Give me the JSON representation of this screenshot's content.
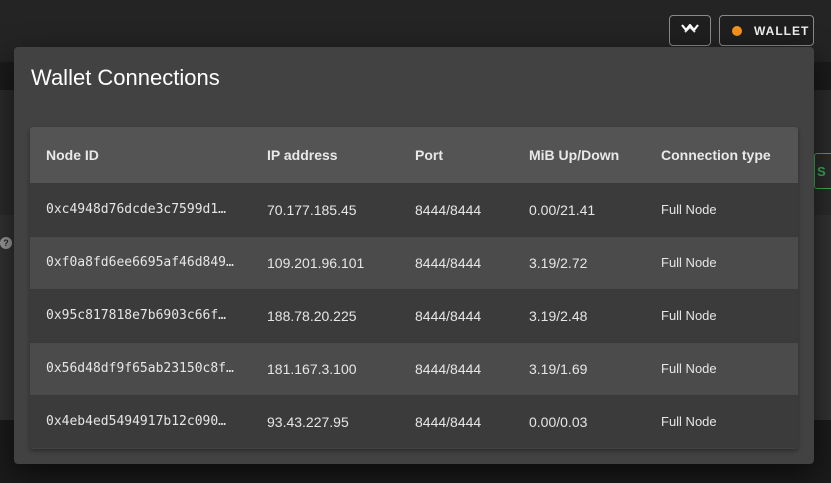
{
  "header": {
    "wallet_button_label": "WALLET",
    "wallet_status_color": "#f7931a",
    "connection_icon": "wave-chia-icon"
  },
  "background": {
    "partial_status_text": "S",
    "help_icon": "?"
  },
  "dialog": {
    "title": "Wallet Connections",
    "columns": [
      "Node ID",
      "IP address",
      "Port",
      "MiB Up/Down",
      "Connection type"
    ],
    "rows": [
      {
        "node_id": "0xc4948d76dcde3c7599d1…",
        "ip": "70.177.185.45",
        "port": "8444/8444",
        "mib": "0.00/21.41",
        "type": "Full Node"
      },
      {
        "node_id": "0xf0a8fd6ee6695af46d849…",
        "ip": "109.201.96.101",
        "port": "8444/8444",
        "mib": "3.19/2.72",
        "type": "Full Node"
      },
      {
        "node_id": "0x95c817818e7b6903c66f…",
        "ip": "188.78.20.225",
        "port": "8444/8444",
        "mib": "3.19/2.48",
        "type": "Full Node"
      },
      {
        "node_id": "0x56d48df9f65ab23150c8f…",
        "ip": "181.167.3.100",
        "port": "8444/8444",
        "mib": "3.19/1.69",
        "type": "Full Node"
      },
      {
        "node_id": "0x4eb4ed5494917b12c090…",
        "ip": "93.43.227.95",
        "port": "8444/8444",
        "mib": "0.00/0.03",
        "type": "Full Node"
      }
    ]
  }
}
